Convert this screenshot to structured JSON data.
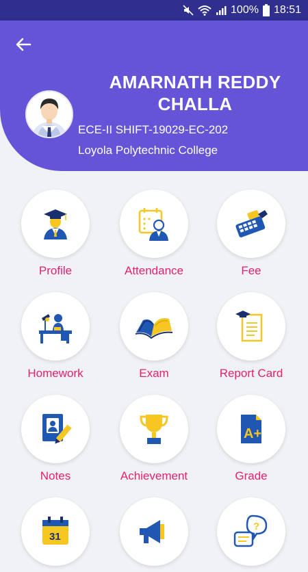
{
  "status": {
    "battery": "100%",
    "time": "18:51"
  },
  "header": {
    "name_line1": "AMARNATH REDDY",
    "name_line2": "CHALLA",
    "class_info": "ECE-II SHIFT-19029-EC-202",
    "college": "Loyola Polytechnic College"
  },
  "colors": {
    "header": "#6455d8",
    "statusbar": "#2f2f8f",
    "label": "#e3206e",
    "icon_blue": "#1f57b3",
    "icon_yellow": "#f6c623"
  },
  "menu": [
    {
      "label": "Profile",
      "icon": "graduate-icon"
    },
    {
      "label": "Attendance",
      "icon": "attendance-icon"
    },
    {
      "label": "Fee",
      "icon": "calculator-icon"
    },
    {
      "label": "Homework",
      "icon": "desk-icon"
    },
    {
      "label": "Exam",
      "icon": "open-book-icon"
    },
    {
      "label": "Report Card",
      "icon": "report-card-icon"
    },
    {
      "label": "Notes",
      "icon": "notes-icon"
    },
    {
      "label": "Achievement",
      "icon": "trophy-icon"
    },
    {
      "label": "Grade",
      "icon": "grade-icon"
    },
    {
      "label": "",
      "icon": "calendar-icon"
    },
    {
      "label": "",
      "icon": "megaphone-icon"
    },
    {
      "label": "",
      "icon": "chat-question-icon"
    }
  ],
  "calendar_day": "31",
  "grade_letter": "A+"
}
